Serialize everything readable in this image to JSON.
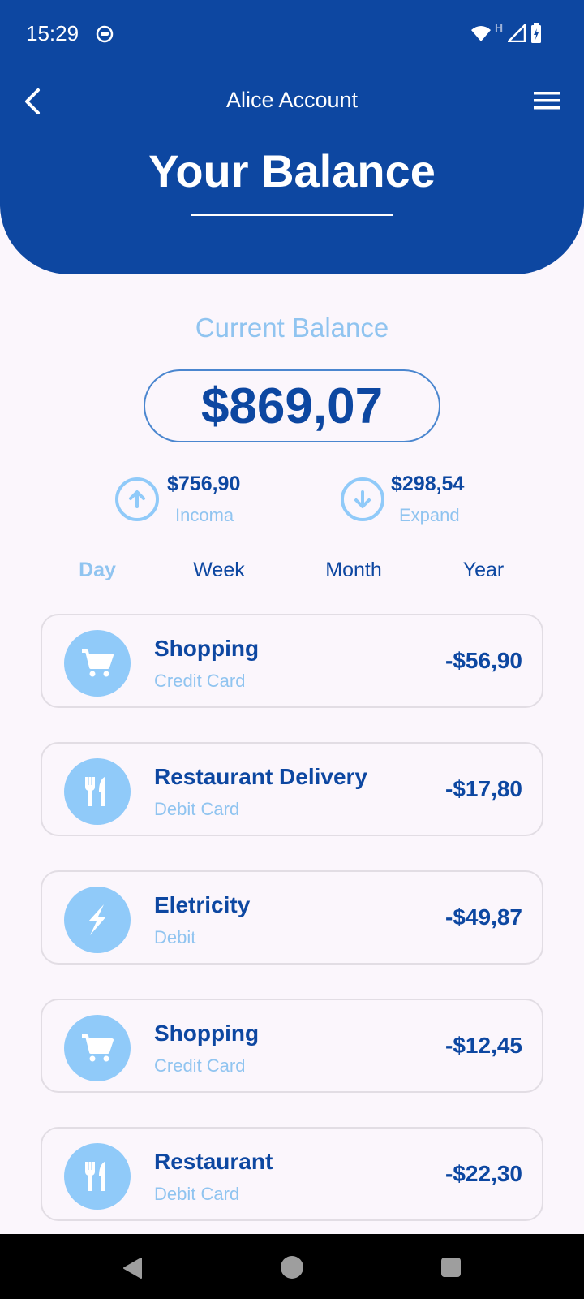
{
  "status_bar": {
    "time": "15:29",
    "left_icon": "sync-face-icon",
    "network_label": "H",
    "icons": [
      "wifi-icon",
      "signal-icon",
      "battery-icon"
    ]
  },
  "header": {
    "account_title": "Alice Account",
    "page_title": "Your Balance",
    "back_icon": "chevron-left-icon",
    "menu_icon": "hamburger-menu-icon"
  },
  "balance": {
    "label": "Current Balance",
    "amount": "$869,07"
  },
  "stats": {
    "income": {
      "amount": "$756,90",
      "label": "Incoma",
      "icon": "arrow-up-circle-icon"
    },
    "expense": {
      "amount": "$298,54",
      "label": "Expand",
      "icon": "arrow-down-circle-icon"
    }
  },
  "tabs": [
    {
      "label": "Day",
      "active": true
    },
    {
      "label": "Week",
      "active": false
    },
    {
      "label": "Month",
      "active": false
    },
    {
      "label": "Year",
      "active": false
    }
  ],
  "transactions": [
    {
      "name": "Shopping",
      "method": "Credit Card",
      "amount": "-$56,90",
      "icon": "cart-icon"
    },
    {
      "name": "Restaurant Delivery",
      "method": "Debit Card",
      "amount": "-$17,80",
      "icon": "fork-knife-icon"
    },
    {
      "name": "Eletricity",
      "method": "Debit",
      "amount": "-$49,87",
      "icon": "lightning-icon"
    },
    {
      "name": "Shopping",
      "method": "Credit Card",
      "amount": "-$12,45",
      "icon": "cart-icon"
    },
    {
      "name": "Restaurant",
      "method": "Debit Card",
      "amount": "-$22,30",
      "icon": "fork-knife-icon"
    }
  ],
  "colors": {
    "primary": "#0d47a1",
    "accent_light": "#90caf9",
    "background": "#fbf6fc"
  }
}
